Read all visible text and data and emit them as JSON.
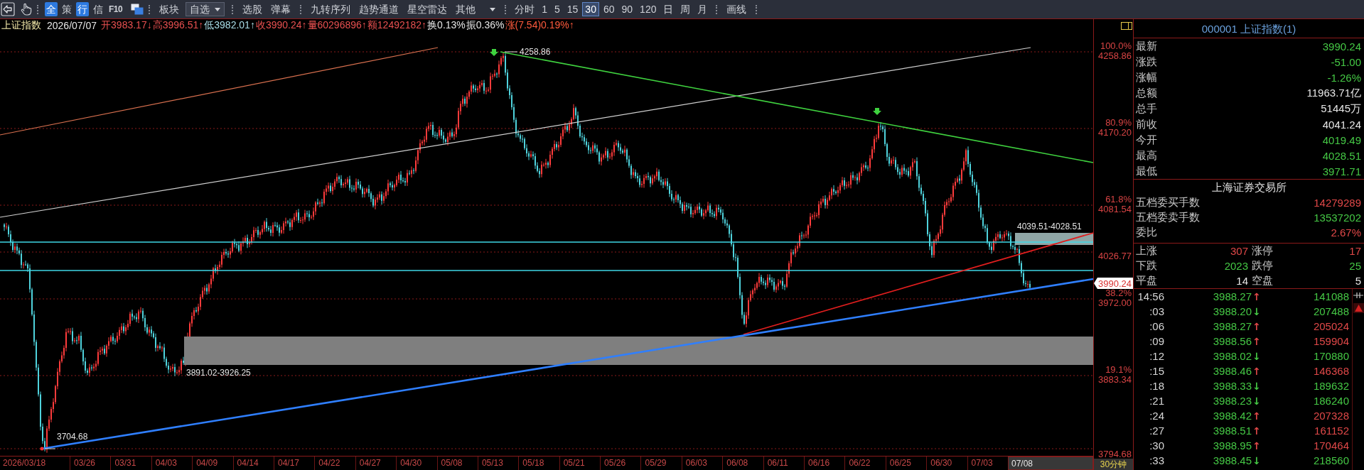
{
  "toolbar": {
    "toggles": [
      {
        "label": "全",
        "on": true
      },
      {
        "label": "策",
        "on": false
      },
      {
        "label": "行",
        "on": true
      },
      {
        "label": "信",
        "on": false
      },
      {
        "label": "F10",
        "on": false
      }
    ],
    "sector_buttons": [
      {
        "label": "板块",
        "kind": "button"
      },
      {
        "label": "自选",
        "kind": "dropdown"
      }
    ],
    "stock_buttons": [
      {
        "label": "选股",
        "kind": "button"
      },
      {
        "label": "弹幕",
        "kind": "button"
      }
    ],
    "indicator_buttons": [
      {
        "label": "九转序列",
        "kind": "button"
      },
      {
        "label": "趋势通道",
        "kind": "button"
      },
      {
        "label": "星空雷达",
        "kind": "button"
      },
      {
        "label": "其他",
        "kind": "menu"
      }
    ],
    "periods": [
      {
        "label": "分时",
        "selected": false
      },
      {
        "label": "1",
        "selected": false
      },
      {
        "label": "5",
        "selected": false
      },
      {
        "label": "15",
        "selected": false
      },
      {
        "label": "30",
        "selected": true
      },
      {
        "label": "60",
        "selected": false
      },
      {
        "label": "90",
        "selected": false
      },
      {
        "label": "120",
        "selected": false
      },
      {
        "label": "日",
        "selected": false
      },
      {
        "label": "周",
        "selected": false
      },
      {
        "label": "月",
        "selected": false
      }
    ],
    "drawing_buttons": [
      {
        "label": "画线",
        "kind": "button"
      }
    ]
  },
  "quote_bar": {
    "name": "上证指数",
    "date": "2026/07/07",
    "fields": [
      {
        "text": "开3983.17↓",
        "color": "#e85050"
      },
      {
        "text": "高3996.51↑",
        "color": "#e85050"
      },
      {
        "text": "低3982.01↑",
        "color": "#a8dce6"
      },
      {
        "text": "收3990.24↑",
        "color": "#e85050"
      },
      {
        "text": "量60296896↑",
        "color": "#e85050"
      },
      {
        "text": "额12492182↑",
        "color": "#e85050"
      },
      {
        "text": "换0.13%",
        "color": "#e6e6e6"
      },
      {
        "text": "振0.36%",
        "color": "#e6e6e6"
      },
      {
        "text": "涨(7.54)0.19%↑",
        "color": "#ff5a3c"
      }
    ]
  },
  "chart": {
    "levels": [
      {
        "percent": "100.0%",
        "price": "4258.86"
      },
      {
        "percent": "80.9%",
        "price": "4170.20"
      },
      {
        "percent": "61.8%",
        "price": "4081.54"
      },
      {
        "price": "4026.77"
      },
      {
        "percent": "38.2%",
        "price": "3972.00"
      },
      {
        "percent": "19.1%",
        "price": "3883.34"
      },
      {
        "price": "3794.68"
      }
    ],
    "price_tag": "3990.24",
    "peak_label": "4258.86",
    "low_label": "3704.68",
    "upper_range_label": "4039.51-4028.51",
    "lower_range_label": "3891.02-3926.25"
  },
  "x_axis": {
    "dates": [
      "2026/03/18",
      "03/26",
      "03/31",
      "04/03",
      "04/09",
      "04/14",
      "04/17",
      "04/22",
      "04/27",
      "04/30",
      "05/08",
      "05/13",
      "05/18",
      "05/21",
      "05/26",
      "05/29",
      "06/03",
      "06/08",
      "06/11",
      "06/16",
      "06/22",
      "06/25",
      "06/30",
      "07/03"
    ],
    "cursor_date": "07/08",
    "period": "30分钟"
  },
  "quote_panel": {
    "code": "000001",
    "name": "上证指数(1)",
    "rows": [
      {
        "label": "最新",
        "value": "3990.24",
        "color": "#45c845"
      },
      {
        "label": "涨跌",
        "value": "-51.00",
        "color": "#45c845"
      },
      {
        "label": "涨幅",
        "value": "-1.26%",
        "color": "#45c845"
      },
      {
        "label": "总额",
        "value": "11963.71亿",
        "color": "#e6e6e6"
      },
      {
        "label": "总手",
        "value": "51445万",
        "color": "#e6e6e6"
      },
      {
        "label": "前收",
        "value": "4041.24",
        "color": "#e6e6e6"
      },
      {
        "label": "今开",
        "value": "4019.49",
        "color": "#45c845"
      },
      {
        "label": "最高",
        "value": "4028.51",
        "color": "#45c845"
      },
      {
        "label": "最低",
        "value": "3971.71",
        "color": "#45c845"
      }
    ]
  },
  "exchange": {
    "title": "上海证券交易所",
    "rows": [
      {
        "label": "五档委买手数",
        "value": "14279289",
        "color": "#e04848"
      },
      {
        "label": "五档委卖手数",
        "value": "13537202",
        "color": "#45c845"
      },
      {
        "label": "委比",
        "value": "2.67%",
        "color": "#e04848"
      }
    ]
  },
  "breadth": [
    {
      "label": "上涨",
      "count": "307",
      "limit_label": "涨停",
      "limit_count": "17",
      "color": "#e04848"
    },
    {
      "label": "下跌",
      "count": "2023",
      "limit_label": "跌停",
      "limit_count": "25",
      "color": "#45c845"
    },
    {
      "label": "平盘",
      "count": "14",
      "limit_label": "空盘",
      "limit_count": "5",
      "color": "#e6e6e6"
    }
  ],
  "ticks": [
    {
      "time": "14:56",
      "price": "3988.27",
      "arrow": {
        "text": "↑",
        "color": "#e04848"
      },
      "volume": {
        "text": "141088",
        "color": "#45c845"
      }
    },
    {
      "time": ":03",
      "price": "3988.20",
      "arrow": {
        "text": "↓",
        "color": "#45c845"
      },
      "volume": {
        "text": "207488",
        "color": "#45c845"
      }
    },
    {
      "time": ":06",
      "price": "3988.27",
      "arrow": {
        "text": "↑",
        "color": "#e04848"
      },
      "volume": {
        "text": "205024",
        "color": "#e04848"
      }
    },
    {
      "time": ":09",
      "price": "3988.56",
      "arrow": {
        "text": "↑",
        "color": "#e04848"
      },
      "volume": {
        "text": "159904",
        "color": "#e04848"
      }
    },
    {
      "time": ":12",
      "price": "3988.02",
      "arrow": {
        "text": "↓",
        "color": "#45c845"
      },
      "volume": {
        "text": "170880",
        "color": "#45c845"
      }
    },
    {
      "time": ":15",
      "price": "3988.46",
      "arrow": {
        "text": "↑",
        "color": "#e04848"
      },
      "volume": {
        "text": "146368",
        "color": "#e04848"
      }
    },
    {
      "time": ":18",
      "price": "3988.33",
      "arrow": {
        "text": "↓",
        "color": "#45c845"
      },
      "volume": {
        "text": "189632",
        "color": "#45c845"
      }
    },
    {
      "time": ":21",
      "price": "3988.23",
      "arrow": {
        "text": "↓",
        "color": "#45c845"
      },
      "volume": {
        "text": "186240",
        "color": "#45c845"
      }
    },
    {
      "time": ":24",
      "price": "3988.42",
      "arrow": {
        "text": "↑",
        "color": "#e04848"
      },
      "volume": {
        "text": "207328",
        "color": "#e04848"
      }
    },
    {
      "time": ":27",
      "price": "3988.51",
      "arrow": {
        "text": "↑",
        "color": "#e04848"
      },
      "volume": {
        "text": "161152",
        "color": "#e04848"
      }
    },
    {
      "time": ":30",
      "price": "3988.95",
      "arrow": {
        "text": "↑",
        "color": "#e04848"
      },
      "volume": {
        "text": "170464",
        "color": "#e04848"
      }
    },
    {
      "time": ":33",
      "price": "3988.45",
      "arrow": {
        "text": "↓",
        "color": "#45c845"
      },
      "volume": {
        "text": "218560",
        "color": "#45c845"
      }
    }
  ]
}
